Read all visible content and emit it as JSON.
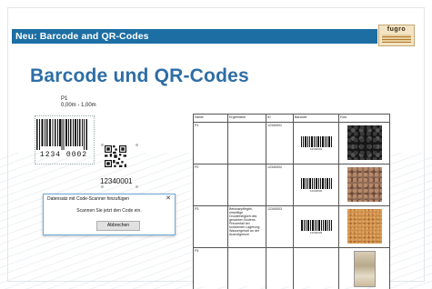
{
  "slide": {
    "header": {
      "title": "Neu: Barcode and QR-Codes"
    },
    "logo": {
      "text": "fugro"
    },
    "main_title": "Barcode und QR-Codes"
  },
  "sample": {
    "point": "P1",
    "depth": "0,00m - 1,00m",
    "barcode_number": "1234  0002",
    "qr_number": "12340001"
  },
  "dialog": {
    "title": "Datensatz mit Code-Scanner hinzufügen",
    "close_label": "✕",
    "message": "Scannen Sie jetzt den Code ein.",
    "button_label": "Abbrechen"
  },
  "table": {
    "headers": [
      "Name",
      "Ergebnisse",
      "ID",
      "Barcode",
      "Foto"
    ],
    "rows": [
      {
        "name": "P1",
        "result": "",
        "id": "12340001",
        "barcode_num": "12340001"
      },
      {
        "name": "P2",
        "result": "",
        "id": "12340002",
        "barcode_num": "12340002"
      },
      {
        "name": "P3",
        "result": "Betonanpflegtel, einseitige Druckfestigkeit des gesichten Bodens. Prinzenfall bei koharenter Lagerung. Wassergehalt an der Ausrollgrenze",
        "id": "12340003",
        "barcode_num": "12340003"
      },
      {
        "name": "P4",
        "result": "",
        "id": "",
        "barcode_num": ""
      }
    ]
  },
  "colors": {
    "header_bar": "#1d6fa3",
    "title": "#2d6ea5"
  }
}
